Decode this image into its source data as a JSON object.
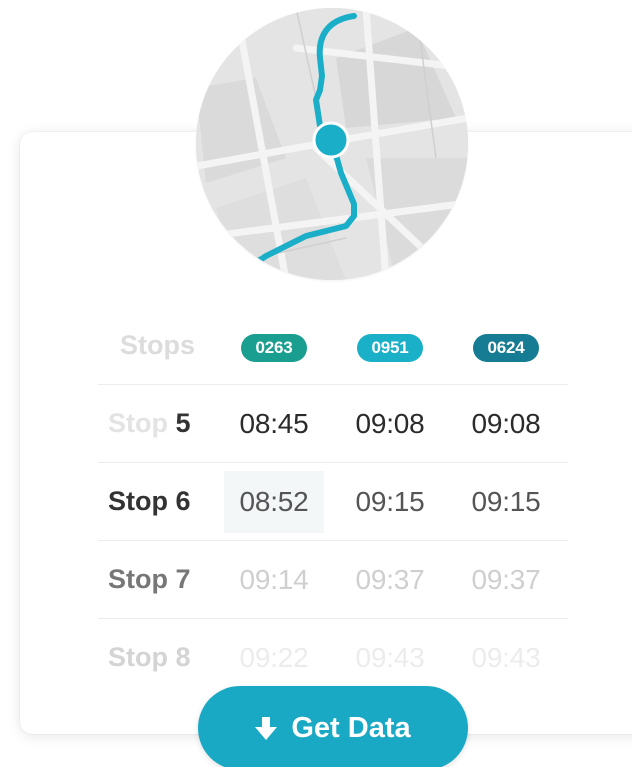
{
  "table": {
    "header_label": "Stops",
    "routes": [
      {
        "code": "0263",
        "color": "#199e90"
      },
      {
        "code": "0951",
        "color": "#1ab0c7"
      },
      {
        "code": "0624",
        "color": "#167c93"
      }
    ],
    "rows": [
      {
        "prefix": "Stop",
        "num": "5",
        "times": [
          "08:45",
          "09:08",
          "09:08"
        ]
      },
      {
        "label": "Stop 6",
        "times": [
          "08:52",
          "09:15",
          "09:15"
        ]
      },
      {
        "label": "Stop 7",
        "times": [
          "09:14",
          "09:37",
          "09:37"
        ]
      },
      {
        "label": "Stop 8",
        "times": [
          "09:22",
          "09:43",
          "09:43"
        ]
      }
    ]
  },
  "button": {
    "label": "Get Data",
    "icon": "download-arrow-icon"
  },
  "map": {
    "route_color": "#1aaec8",
    "icon": "route-map-icon"
  }
}
